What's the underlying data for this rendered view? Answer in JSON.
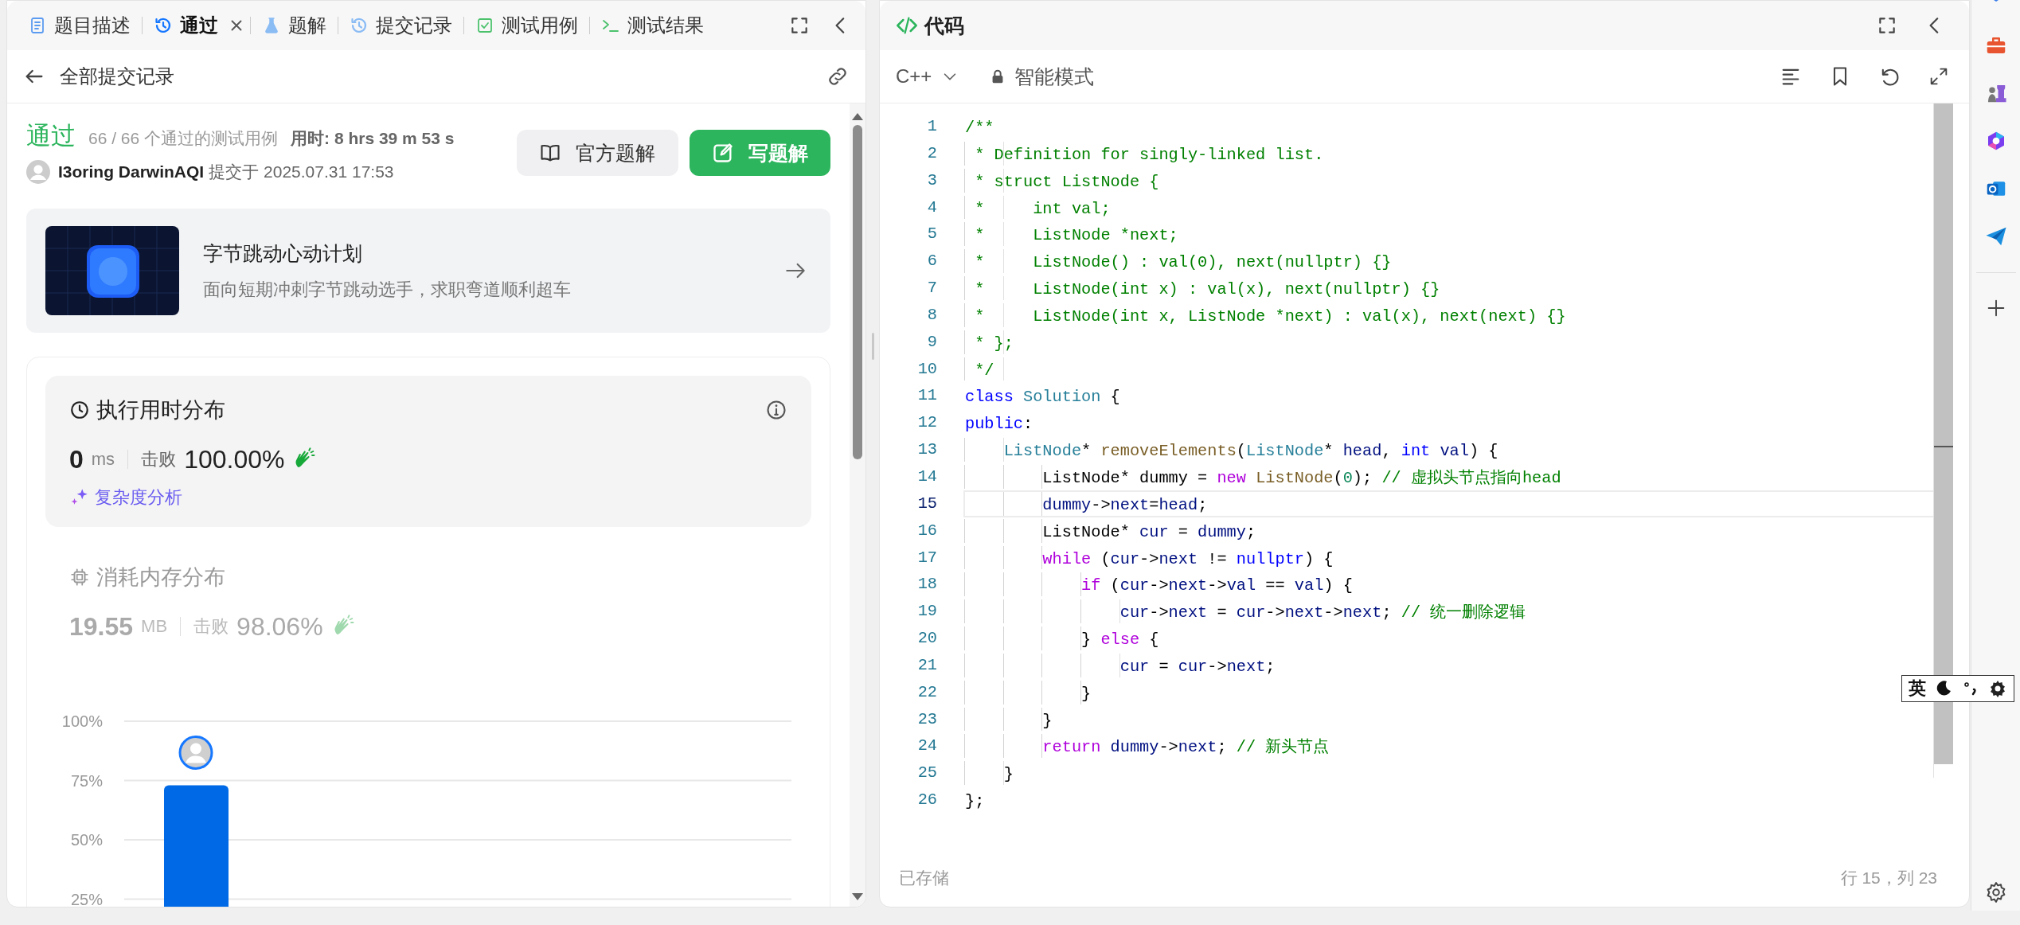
{
  "problem_panel": {
    "tabs": [
      {
        "label": "题目描述",
        "selected": false,
        "closable": false
      },
      {
        "label": "通过",
        "selected": true,
        "closable": true
      },
      {
        "label": "题解",
        "selected": false,
        "closable": false
      },
      {
        "label": "提交记录",
        "selected": false,
        "closable": false
      },
      {
        "label": "测试用例",
        "selected": false,
        "closable": false
      },
      {
        "label": "测试结果",
        "selected": false,
        "closable": false
      }
    ],
    "back_label": "全部提交记录",
    "submission": {
      "status": "通过",
      "cases": "66 / 66 个通过的测试用例",
      "runtime": "用时: 8 hrs 39 m 53 s",
      "author": "I3oring DarwinAQI",
      "submitted": "提交于 2025.07.31 17:53",
      "buttons": [
        {
          "label": "官方题解",
          "kind": "secondary"
        },
        {
          "label": "写题解",
          "kind": "primary"
        }
      ]
    },
    "promo": {
      "title": "字节跳动心动计划",
      "subtitle": "面向短期冲刺字节跳动选手，求职弯道顺利超车"
    },
    "distributions": [
      {
        "title": "执行用时分布",
        "value": "0",
        "unit": "ms",
        "beats_label": "击败",
        "beats": "100.00%",
        "selected": true,
        "link": "复杂度分析"
      },
      {
        "title": "消耗内存分布",
        "value": "19.55",
        "unit": "MB",
        "beats_label": "击败",
        "beats": "98.06%",
        "selected": false
      }
    ],
    "chart_data": {
      "type": "bar",
      "values": [
        73
      ],
      "ylim": [
        0,
        100
      ],
      "grid": true,
      "yticks": [
        {
          "value": 25,
          "label": "25%"
        },
        {
          "value": 50,
          "label": "50%"
        },
        {
          "value": 75,
          "label": "75%"
        },
        {
          "value": 100,
          "label": "100%"
        }
      ]
    }
  },
  "code_panel": {
    "title": "代码",
    "language": "C++",
    "mode": "智能模式",
    "lines": [
      {
        "no": "1",
        "current": false,
        "tokens": [
          {
            "kind": "comment",
            "text": "/**"
          }
        ]
      },
      {
        "no": "2",
        "current": false,
        "tokens": [
          {
            "kind": "comment",
            "text": " * Definition for singly-linked list."
          }
        ]
      },
      {
        "no": "3",
        "current": false,
        "tokens": [
          {
            "kind": "comment",
            "text": " * struct ListNode {"
          }
        ]
      },
      {
        "no": "4",
        "current": false,
        "tokens": [
          {
            "kind": "comment",
            "text": " *     int val;"
          }
        ]
      },
      {
        "no": "5",
        "current": false,
        "tokens": [
          {
            "kind": "comment",
            "text": " *     ListNode *next;"
          }
        ]
      },
      {
        "no": "6",
        "current": false,
        "tokens": [
          {
            "kind": "comment",
            "text": " *     ListNode() : val(0), next(nullptr) {}"
          }
        ]
      },
      {
        "no": "7",
        "current": false,
        "tokens": [
          {
            "kind": "comment",
            "text": " *     ListNode(int x) : val(x), next(nullptr) {}"
          }
        ]
      },
      {
        "no": "8",
        "current": false,
        "tokens": [
          {
            "kind": "comment",
            "text": " *     ListNode(int x, ListNode *next) : val(x), next(next) {}"
          }
        ]
      },
      {
        "no": "9",
        "current": false,
        "tokens": [
          {
            "kind": "comment",
            "text": " * };"
          }
        ]
      },
      {
        "no": "10",
        "current": false,
        "tokens": [
          {
            "kind": "comment",
            "text": " */"
          }
        ]
      },
      {
        "no": "11",
        "current": false,
        "tokens": [
          {
            "kind": "keyword",
            "text": "class"
          },
          {
            "kind": "type",
            "text": " Solution"
          },
          {
            "kind": "plain",
            "text": " {"
          }
        ]
      },
      {
        "no": "12",
        "current": false,
        "tokens": [
          {
            "kind": "keyword",
            "text": "public"
          },
          {
            "kind": "plain",
            "text": ":"
          }
        ]
      },
      {
        "no": "13",
        "current": false,
        "tokens": [
          {
            "kind": "type",
            "text": "    ListNode"
          },
          {
            "kind": "plain",
            "text": "* "
          },
          {
            "kind": "function",
            "text": "removeElements"
          },
          {
            "kind": "plain",
            "text": "("
          },
          {
            "kind": "type",
            "text": "ListNode"
          },
          {
            "kind": "plain",
            "text": "* "
          },
          {
            "kind": "variable",
            "text": "head"
          },
          {
            "kind": "plain",
            "text": ", "
          },
          {
            "kind": "keyword",
            "text": "int"
          },
          {
            "kind": "variable",
            "text": " val"
          },
          {
            "kind": "plain",
            "text": ") {"
          }
        ]
      },
      {
        "no": "14",
        "current": false,
        "tokens": [
          {
            "kind": "plain",
            "text": "        ListNode* dummy = "
          },
          {
            "kind": "control",
            "text": "new"
          },
          {
            "kind": "function",
            "text": " ListNode"
          },
          {
            "kind": "plain",
            "text": "("
          },
          {
            "kind": "number",
            "text": "0"
          },
          {
            "kind": "plain",
            "text": "); "
          },
          {
            "kind": "comment",
            "text": "// 虚拟头节点指向head"
          }
        ]
      },
      {
        "no": "15",
        "current": true,
        "tokens": [
          {
            "kind": "variable",
            "text": "        dummy"
          },
          {
            "kind": "plain",
            "text": "->"
          },
          {
            "kind": "variable",
            "text": "next"
          },
          {
            "kind": "plain",
            "text": "="
          },
          {
            "kind": "variable",
            "text": "head"
          },
          {
            "kind": "plain",
            "text": ";"
          }
        ]
      },
      {
        "no": "16",
        "current": false,
        "tokens": [
          {
            "kind": "plain",
            "text": "        ListNode* "
          },
          {
            "kind": "variable",
            "text": "cur"
          },
          {
            "kind": "plain",
            "text": " = "
          },
          {
            "kind": "variable",
            "text": "dummy"
          },
          {
            "kind": "plain",
            "text": ";"
          }
        ]
      },
      {
        "no": "17",
        "current": false,
        "tokens": [
          {
            "kind": "control",
            "text": "        while"
          },
          {
            "kind": "plain",
            "text": " ("
          },
          {
            "kind": "variable",
            "text": "cur"
          },
          {
            "kind": "plain",
            "text": "->"
          },
          {
            "kind": "variable",
            "text": "next"
          },
          {
            "kind": "plain",
            "text": " != "
          },
          {
            "kind": "keyword",
            "text": "nullptr"
          },
          {
            "kind": "plain",
            "text": ") {"
          }
        ]
      },
      {
        "no": "18",
        "current": false,
        "tokens": [
          {
            "kind": "control",
            "text": "            if"
          },
          {
            "kind": "plain",
            "text": " ("
          },
          {
            "kind": "variable",
            "text": "cur"
          },
          {
            "kind": "plain",
            "text": "->"
          },
          {
            "kind": "variable",
            "text": "next"
          },
          {
            "kind": "plain",
            "text": "->"
          },
          {
            "kind": "variable",
            "text": "val"
          },
          {
            "kind": "plain",
            "text": " == "
          },
          {
            "kind": "variable",
            "text": "val"
          },
          {
            "kind": "plain",
            "text": ") {"
          }
        ]
      },
      {
        "no": "19",
        "current": false,
        "tokens": [
          {
            "kind": "variable",
            "text": "                cur"
          },
          {
            "kind": "plain",
            "text": "->"
          },
          {
            "kind": "variable",
            "text": "next"
          },
          {
            "kind": "plain",
            "text": " = "
          },
          {
            "kind": "variable",
            "text": "cur"
          },
          {
            "kind": "plain",
            "text": "->"
          },
          {
            "kind": "variable",
            "text": "next"
          },
          {
            "kind": "plain",
            "text": "->"
          },
          {
            "kind": "variable",
            "text": "next"
          },
          {
            "kind": "plain",
            "text": "; "
          },
          {
            "kind": "comment",
            "text": "// 统一删除逻辑"
          }
        ]
      },
      {
        "no": "20",
        "current": false,
        "tokens": [
          {
            "kind": "plain",
            "text": "            } "
          },
          {
            "kind": "control",
            "text": "else"
          },
          {
            "kind": "plain",
            "text": " {"
          }
        ]
      },
      {
        "no": "21",
        "current": false,
        "tokens": [
          {
            "kind": "variable",
            "text": "                cur"
          },
          {
            "kind": "plain",
            "text": " = "
          },
          {
            "kind": "variable",
            "text": "cur"
          },
          {
            "kind": "plain",
            "text": "->"
          },
          {
            "kind": "variable",
            "text": "next"
          },
          {
            "kind": "plain",
            "text": ";"
          }
        ]
      },
      {
        "no": "22",
        "current": false,
        "tokens": [
          {
            "kind": "plain",
            "text": "            }"
          }
        ]
      },
      {
        "no": "23",
        "current": false,
        "tokens": [
          {
            "kind": "plain",
            "text": "        }"
          }
        ]
      },
      {
        "no": "24",
        "current": false,
        "tokens": [
          {
            "kind": "control",
            "text": "        return"
          },
          {
            "kind": "variable",
            "text": " dummy"
          },
          {
            "kind": "plain",
            "text": "->"
          },
          {
            "kind": "variable",
            "text": "next"
          },
          {
            "kind": "plain",
            "text": "; "
          },
          {
            "kind": "comment",
            "text": "// 新头节点"
          }
        ]
      },
      {
        "no": "25",
        "current": false,
        "tokens": [
          {
            "kind": "plain",
            "text": "    }"
          }
        ]
      },
      {
        "no": "26",
        "current": false,
        "tokens": [
          {
            "kind": "plain",
            "text": "};"
          }
        ]
      }
    ],
    "status": "已存储",
    "cursor": "行 15，列 23"
  },
  "ime_toolbar": {
    "label": "英"
  }
}
